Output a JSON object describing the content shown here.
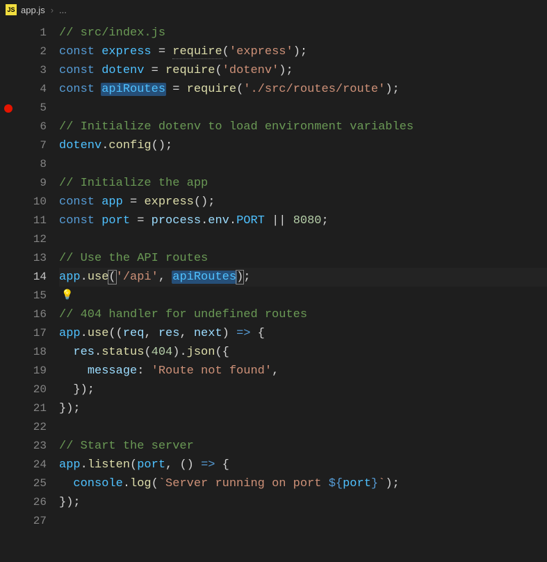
{
  "tab": {
    "filename": "app.js",
    "icon_label": "JS",
    "breadcrumb_more": "..."
  },
  "lines": [
    {
      "n": 1,
      "breakpoint": false
    },
    {
      "n": 2,
      "breakpoint": false
    },
    {
      "n": 3,
      "breakpoint": false
    },
    {
      "n": 4,
      "breakpoint": false
    },
    {
      "n": 5,
      "breakpoint": true
    },
    {
      "n": 6,
      "breakpoint": false
    },
    {
      "n": 7,
      "breakpoint": false
    },
    {
      "n": 8,
      "breakpoint": false
    },
    {
      "n": 9,
      "breakpoint": false
    },
    {
      "n": 10,
      "breakpoint": false
    },
    {
      "n": 11,
      "breakpoint": false
    },
    {
      "n": 12,
      "breakpoint": false
    },
    {
      "n": 13,
      "breakpoint": false
    },
    {
      "n": 14,
      "breakpoint": false,
      "current": true
    },
    {
      "n": 15,
      "breakpoint": false,
      "bulb": true
    },
    {
      "n": 16,
      "breakpoint": false
    },
    {
      "n": 17,
      "breakpoint": false
    },
    {
      "n": 18,
      "breakpoint": false
    },
    {
      "n": 19,
      "breakpoint": false
    },
    {
      "n": 20,
      "breakpoint": false
    },
    {
      "n": 21,
      "breakpoint": false
    },
    {
      "n": 22,
      "breakpoint": false
    },
    {
      "n": 23,
      "breakpoint": false
    },
    {
      "n": 24,
      "breakpoint": false
    },
    {
      "n": 25,
      "breakpoint": false
    },
    {
      "n": 26,
      "breakpoint": false
    },
    {
      "n": 27,
      "breakpoint": false
    }
  ],
  "code": {
    "l1_comment": "// src/index.js",
    "l2_const": "const",
    "l2_var": "express",
    "l2_eq": " = ",
    "l2_req": "require",
    "l2_p1": "(",
    "l2_str": "'express'",
    "l2_p2": ")",
    "l2_semi": ";",
    "l3_const": "const",
    "l3_var": "dotenv",
    "l3_eq": " = ",
    "l3_req": "require",
    "l3_p1": "(",
    "l3_str": "'dotenv'",
    "l3_p2": ")",
    "l3_semi": ";",
    "l4_const": "const",
    "l4_var": "apiRoutes",
    "l4_eq": " = ",
    "l4_req": "require",
    "l4_p1": "(",
    "l4_str": "'./src/routes/route'",
    "l4_p2": ")",
    "l4_semi": ";",
    "l6_comment": "// Initialize dotenv to load environment variables",
    "l7_obj": "dotenv",
    "l7_dot": ".",
    "l7_func": "config",
    "l7_p": "()",
    "l7_semi": ";",
    "l9_comment": "// Initialize the app",
    "l10_const": "const",
    "l10_var": "app",
    "l10_eq": " = ",
    "l10_func": "express",
    "l10_p": "()",
    "l10_semi": ";",
    "l11_const": "const",
    "l11_var": "port",
    "l11_eq": " = ",
    "l11_proc": "process",
    "l11_d1": ".",
    "l11_env": "env",
    "l11_d2": ".",
    "l11_port": "PORT",
    "l11_or": " || ",
    "l11_num": "8080",
    "l11_semi": ";",
    "l13_comment": "// Use the API routes",
    "l14_app": "app",
    "l14_dot": ".",
    "l14_use": "use",
    "l14_p1": "(",
    "l14_str": "'/api'",
    "l14_comma": ", ",
    "l14_arg": "apiRoutes",
    "l14_p2": ")",
    "l14_semi": ";",
    "l16_comment": "// 404 handler for undefined routes",
    "l17_app": "app",
    "l17_dot": ".",
    "l17_use": "use",
    "l17_p1": "((",
    "l17_req": "req",
    "l17_c1": ", ",
    "l17_res": "res",
    "l17_c2": ", ",
    "l17_next": "next",
    "l17_p2": ") ",
    "l17_arrow": "=>",
    "l17_brace": " {",
    "l18_res": "res",
    "l18_d1": ".",
    "l18_status": "status",
    "l18_p1": "(",
    "l18_num": "404",
    "l18_p2": ").",
    "l18_json": "json",
    "l18_p3": "({",
    "l19_msg": "message",
    "l19_colon": ": ",
    "l19_str": "'Route not found'",
    "l19_comma": ",",
    "l20_close": "});",
    "l21_close": "});",
    "l23_comment": "// Start the server",
    "l24_app": "app",
    "l24_dot": ".",
    "l24_listen": "listen",
    "l24_p1": "(",
    "l24_port": "port",
    "l24_comma": ", () ",
    "l24_arrow": "=>",
    "l24_brace": " {",
    "l25_console": "console",
    "l25_dot": ".",
    "l25_log": "log",
    "l25_p1": "(",
    "l25_tick1": "`Server running on port ",
    "l25_interp1": "${",
    "l25_pvar": "port",
    "l25_interp2": "}",
    "l25_tick2": "`",
    "l25_p2": ")",
    "l25_semi": ";",
    "l26_close": "});"
  }
}
